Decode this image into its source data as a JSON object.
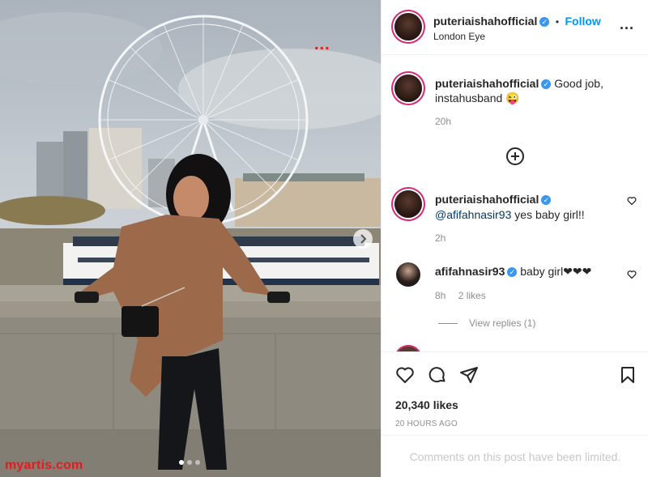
{
  "post": {
    "username": "puteriaishahofficial",
    "separator": "•",
    "follow_label": "Follow",
    "location": "London Eye",
    "more_label": "..."
  },
  "caption": {
    "username": "puteriaishahofficial",
    "text": "Good job, instahusband 😜",
    "time": "20h"
  },
  "comments": [
    {
      "username": "puteriaishahofficial",
      "mention": "@afifahnasir93",
      "text": "yes baby girl!!",
      "time": "2h"
    },
    {
      "username": "afifahnasir93",
      "text": "baby girl❤❤❤",
      "time": "8h",
      "likes": "2 likes",
      "view_replies": "View replies (1)"
    }
  ],
  "stats": {
    "likes": "20,340 likes",
    "age": "20 HOURS AGO",
    "comments_limited": "Comments on this post have been limited."
  },
  "watermark": "myartis.com",
  "photo_overlay_dots": "...",
  "colors": {
    "accent": "#0095f6",
    "verified": "#3897f0",
    "watermark": "#e8191c",
    "hearts": "#ed4956"
  },
  "icons": {
    "load_more": "plus-circle-icon",
    "like": "heart-icon",
    "comment": "comment-icon",
    "share": "send-icon",
    "save": "bookmark-icon",
    "next": "chevron-right-icon"
  }
}
